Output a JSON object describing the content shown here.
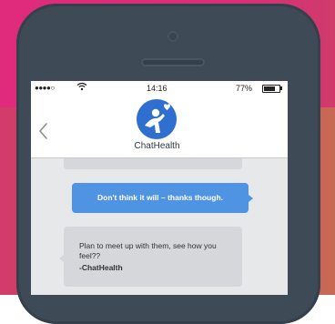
{
  "status_bar": {
    "signal": "●●●●○",
    "time": "14:16",
    "battery_percent": "77%",
    "battery_level": 0.77
  },
  "header": {
    "back_icon": "chevron-left-icon",
    "logo_icon": "chathealth-person-heart-logo",
    "app_name": "ChatHealth"
  },
  "messages": [
    {
      "direction": "outgoing",
      "text": "Don't think it will – thanks though."
    },
    {
      "direction": "incoming",
      "text": "Plan to meet up with them, see how you feel??",
      "signature": "-ChatHealth"
    }
  ],
  "colors": {
    "background_pink": "#da2f79",
    "phone_body": "#3f4a57",
    "outgoing_bubble": "#4e94e3",
    "incoming_bubble": "#d5d7da",
    "logo_blue": "#2e6fcf"
  }
}
